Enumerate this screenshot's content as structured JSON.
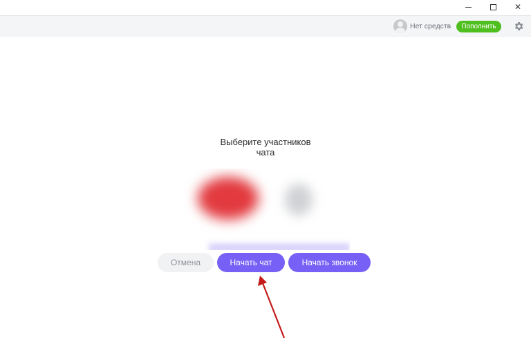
{
  "window": {
    "minimize_icon": "minimize-icon",
    "maximize_icon": "maximize-icon",
    "close_label": "✕"
  },
  "toolbar": {
    "balance_text": "Нет средств",
    "topup_label": "Пополнить",
    "settings_icon": "gear-icon",
    "topup_color": "#4fbf1f"
  },
  "dialog": {
    "title_line1": "Выберите участников",
    "title_line2": "чата",
    "cancel_label": "Отмена",
    "start_chat_label": "Начать чат",
    "start_call_label": "Начать звонок",
    "accent_color": "#7760f5"
  }
}
